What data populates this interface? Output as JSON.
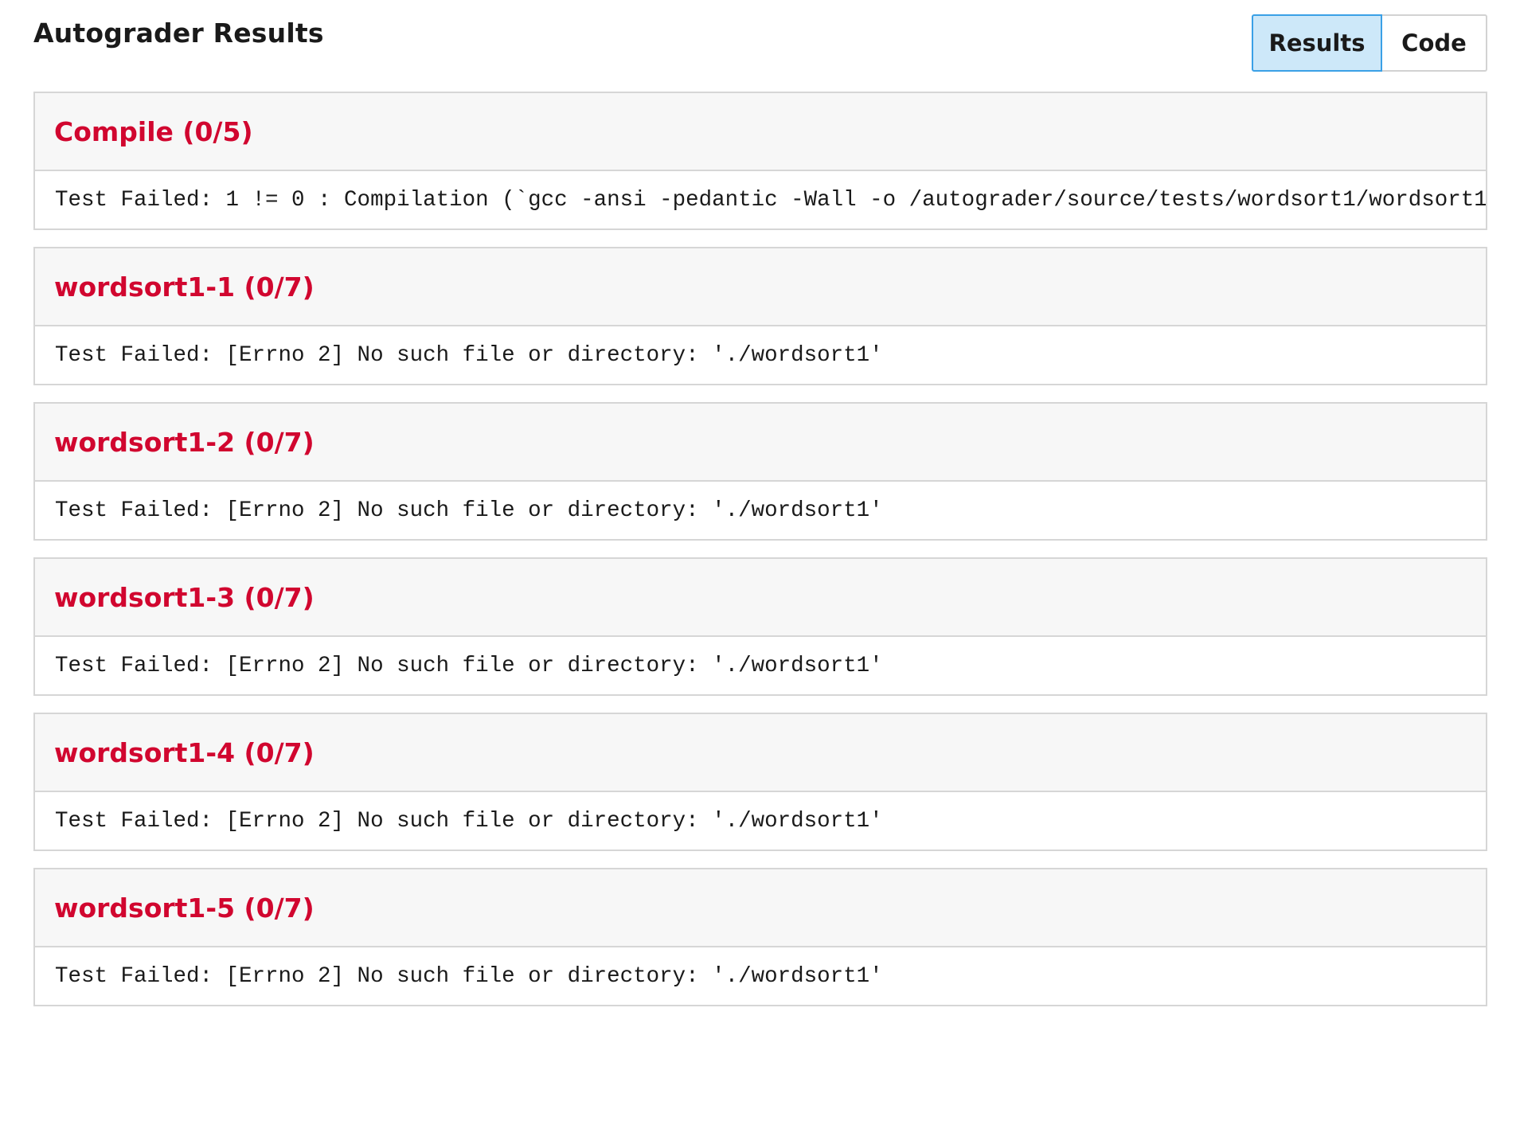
{
  "page_title": "Autograder Results",
  "tabs": {
    "results_label": "Results",
    "code_label": "Code",
    "active": "Results"
  },
  "colors": {
    "failed_title": "#d1062f",
    "active_tab_bg": "#cde8f9",
    "active_tab_border": "#3aa0e6"
  },
  "tests": [
    {
      "title": "Compile (0/5)",
      "output": "Test Failed: 1 != 0 : Compilation (`gcc -ansi -pedantic -Wall -o /autograder/source/tests/wordsort1/wordsort1"
    },
    {
      "title": "wordsort1-1 (0/7)",
      "output": "Test Failed: [Errno 2] No such file or directory: './wordsort1'"
    },
    {
      "title": "wordsort1-2 (0/7)",
      "output": "Test Failed: [Errno 2] No such file or directory: './wordsort1'"
    },
    {
      "title": "wordsort1-3 (0/7)",
      "output": "Test Failed: [Errno 2] No such file or directory: './wordsort1'"
    },
    {
      "title": "wordsort1-4 (0/7)",
      "output": "Test Failed: [Errno 2] No such file or directory: './wordsort1'"
    },
    {
      "title": "wordsort1-5 (0/7)",
      "output": "Test Failed: [Errno 2] No such file or directory: './wordsort1'"
    }
  ]
}
